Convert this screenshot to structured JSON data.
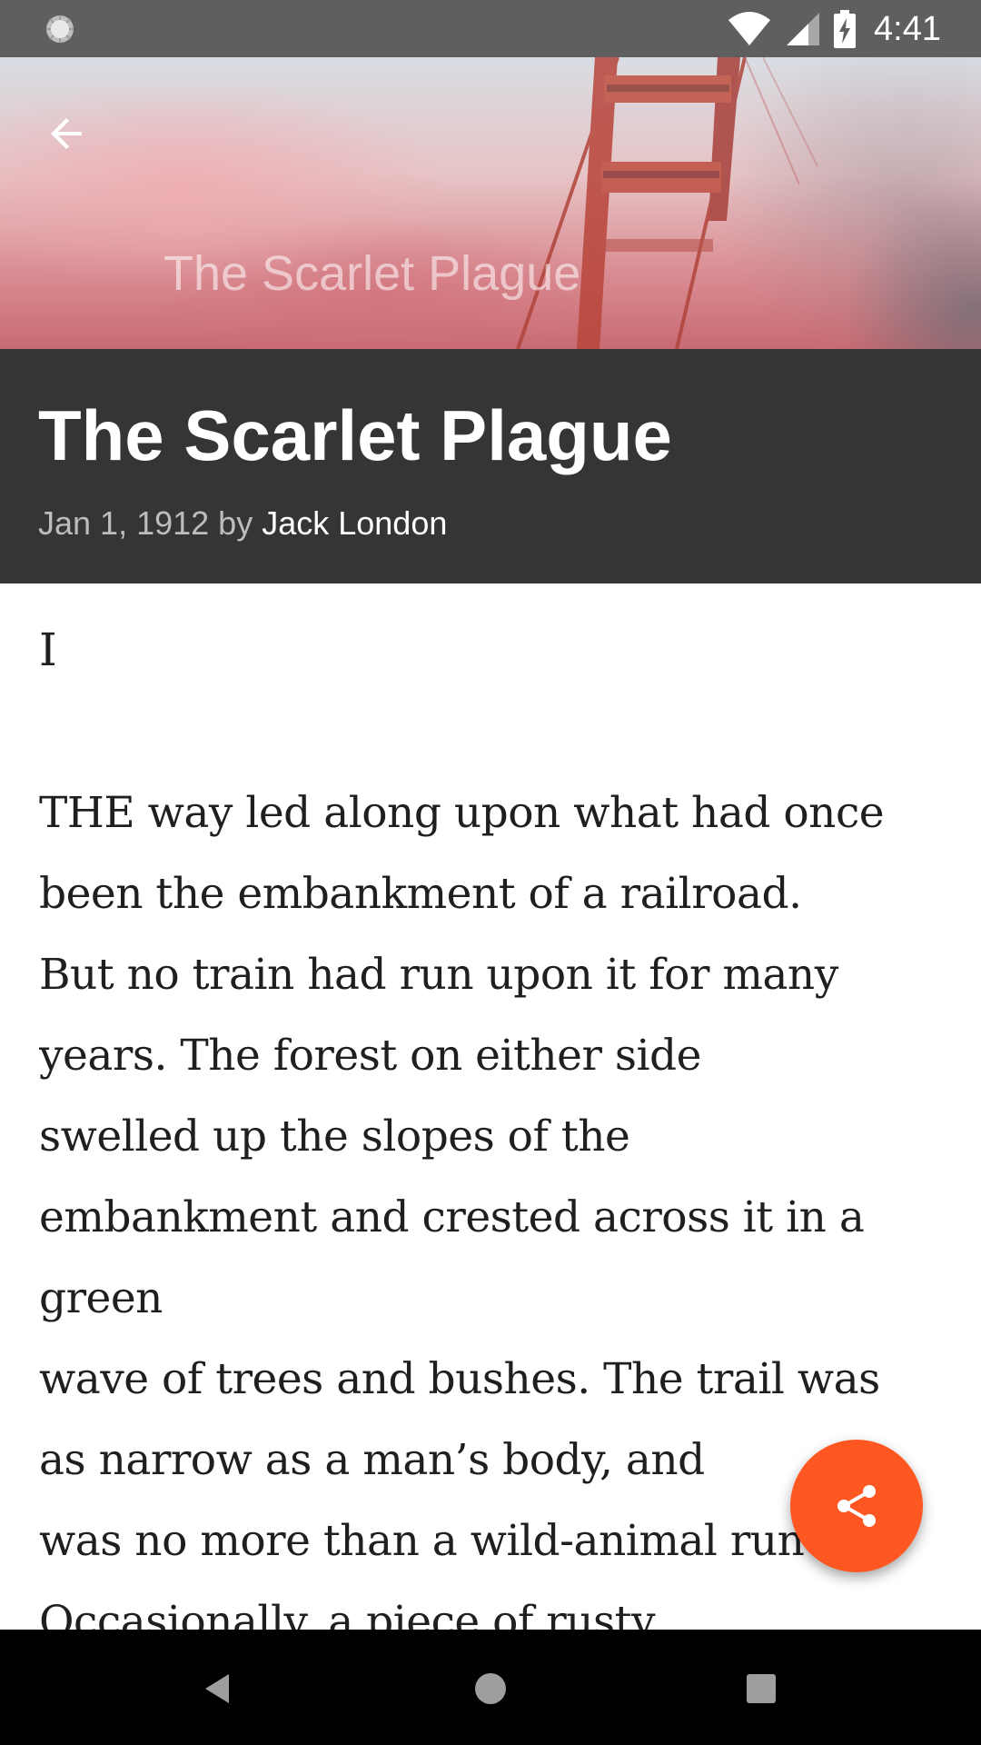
{
  "status_bar": {
    "time": "4:41",
    "icons": [
      "sync-spinner-icon",
      "wifi-icon",
      "cellular-signal-icon",
      "battery-charging-icon"
    ]
  },
  "hero": {
    "image_overlay_title": "The Scarlet Plague",
    "back_icon": "arrow-back-icon"
  },
  "article": {
    "title": "The Scarlet Plague",
    "date": "Jan 1, 1912",
    "by_label": "by",
    "author": "Jack London",
    "chapter": "I",
    "lines": [
      "THE way led along upon what had once",
      "been the embankment of a railroad.",
      "But no train had run upon it for many",
      "years. The forest on either side",
      "swelled up the slopes of the",
      "embankment and crested across it in a",
      "green",
      "wave of trees and bushes. The trail was",
      "as narrow as a man’s body, and",
      "was no more than a wild-animal runway.",
      "Occasionally, a piece of rusty"
    ]
  },
  "fab": {
    "icon": "share-icon",
    "color": "#ff5722"
  },
  "nav_bar": {
    "icons": [
      "nav-back-icon",
      "nav-home-icon",
      "nav-recents-icon"
    ]
  },
  "colors": {
    "status_bar": "#5f5f5f",
    "title_block": "#353535",
    "accent": "#ff5722"
  }
}
